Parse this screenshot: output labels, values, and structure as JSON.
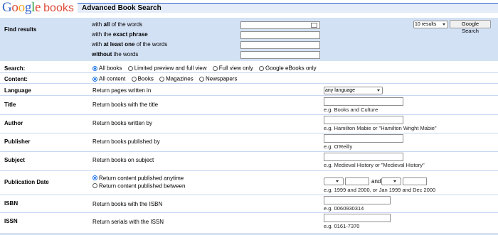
{
  "header": {
    "logo_google": "Google",
    "logo_books": "books",
    "title": "Advanced Book Search"
  },
  "brand_colors": {
    "G": "#3366cc",
    "o1": "#dd4b39",
    "o2": "#f5a623",
    "g": "#3366cc",
    "l": "#2a9d3b",
    "e": "#dd4b39"
  },
  "find_results": {
    "label": "Find results",
    "rows": [
      {
        "pre": "with ",
        "bold": "all",
        "post": " of the words",
        "value": ""
      },
      {
        "pre": "with the ",
        "bold": "exact phrase",
        "post": "",
        "value": ""
      },
      {
        "pre": "with ",
        "bold": "at least one",
        "post": " of the words",
        "value": ""
      },
      {
        "pre": "",
        "bold": "without",
        "post": " the words",
        "value": ""
      }
    ],
    "results_select": "10 results",
    "search_button": "Google Search"
  },
  "search": {
    "label": "Search:",
    "options": [
      "All books",
      "Limited preview and full view",
      "Full view only",
      "Google eBooks only"
    ],
    "selected": "All books"
  },
  "content": {
    "label": "Content:",
    "options": [
      "All content",
      "Books",
      "Magazines",
      "Newspapers"
    ],
    "selected": "All content"
  },
  "language": {
    "label": "Language",
    "desc": "Return pages written in",
    "value": "any language"
  },
  "fields": {
    "title": {
      "label": "Title",
      "desc": "Return books with the title",
      "example": "e.g. Books and Culture",
      "value": ""
    },
    "author": {
      "label": "Author",
      "desc": "Return books written by",
      "example": "e.g. Hamilton Mabie or \"Hamilton Wright Mabie\"",
      "value": ""
    },
    "publisher": {
      "label": "Publisher",
      "desc": "Return books published by",
      "example": "e.g. O'Reilly",
      "value": ""
    },
    "subject": {
      "label": "Subject",
      "desc": "Return books on subject",
      "example": "e.g. Medieval History or \"Medieval History\"",
      "value": ""
    },
    "isbn": {
      "label": "ISBN",
      "desc": "Return books with the ISBN",
      "example": "e.g. 0060930314",
      "value": ""
    },
    "issn": {
      "label": "ISSN",
      "desc": "Return serials with the ISSN",
      "example": "e.g. 0161-7370",
      "value": ""
    }
  },
  "publication_date": {
    "label": "Publication Date",
    "option_anytime": "Return content published anytime",
    "option_between": "Return content published between",
    "selected": "anytime",
    "and_label": "and",
    "example": "e.g. 1999 and 2000, or Jan 1999 and Dec 2000"
  }
}
